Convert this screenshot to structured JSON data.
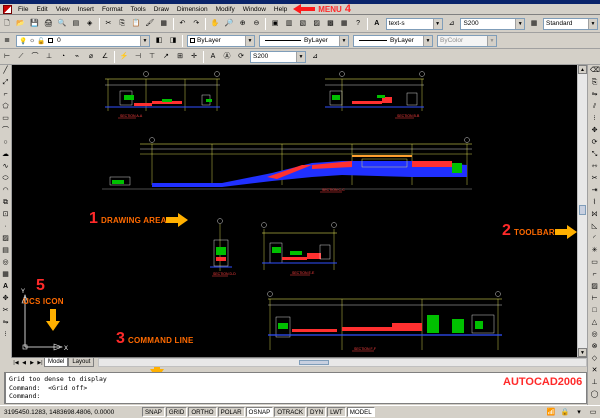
{
  "menu": {
    "items": [
      "File",
      "Edit",
      "View",
      "Insert",
      "Format",
      "Tools",
      "Draw",
      "Dimension",
      "Modify",
      "Window",
      "Help"
    ],
    "annotation_label": "MENU",
    "annotation_number": "4"
  },
  "toolbar_top": {
    "text_style": "text-s",
    "dim_scale": "S200",
    "table_style": "Standard"
  },
  "toolbar_layers": {
    "layer_name": "0",
    "color": "ByLayer",
    "linetype": "ByLayer",
    "lineweight": "ByLayer",
    "plot_style": "ByColor"
  },
  "toolbar_dim": {
    "dim_style": "S200"
  },
  "drawing": {
    "section_labels": [
      "SECTION A-A",
      "SECTION B-B",
      "SECTION C-C",
      "SECTION D-D",
      "SECTION E-E",
      "SECTION F-F"
    ],
    "axis_y": "Y",
    "axis_x": "X"
  },
  "annotations": {
    "drawing_area": {
      "number": "1",
      "label": "DRAWING AREA"
    },
    "toolbar": {
      "number": "2",
      "label": "TOOLBAR"
    },
    "command_line": {
      "number": "3",
      "label": "COMMAND LINE"
    },
    "ucs_icon": {
      "number": "5",
      "label": "UCS ICON"
    },
    "product": "AUTOCAD2006",
    "colors": {
      "red": "#ff2a2a",
      "orange": "#ff6a00",
      "arrow": "#ffb000"
    }
  },
  "tabs": [
    "Model",
    "Layout"
  ],
  "command": {
    "lines": [
      "Grid too dense to display",
      "Command:  <Grid off>",
      "Command:"
    ]
  },
  "status": {
    "coordinates": "3195450.1283, 1483698.4806, 0.0000",
    "buttons": [
      {
        "label": "SNAP",
        "on": false
      },
      {
        "label": "GRID",
        "on": false
      },
      {
        "label": "ORTHO",
        "on": false
      },
      {
        "label": "POLAR",
        "on": false
      },
      {
        "label": "OSNAP",
        "on": true
      },
      {
        "label": "OTRACK",
        "on": false
      },
      {
        "label": "DYN",
        "on": false
      },
      {
        "label": "LWT",
        "on": false
      },
      {
        "label": "MODEL",
        "on": true
      }
    ]
  }
}
